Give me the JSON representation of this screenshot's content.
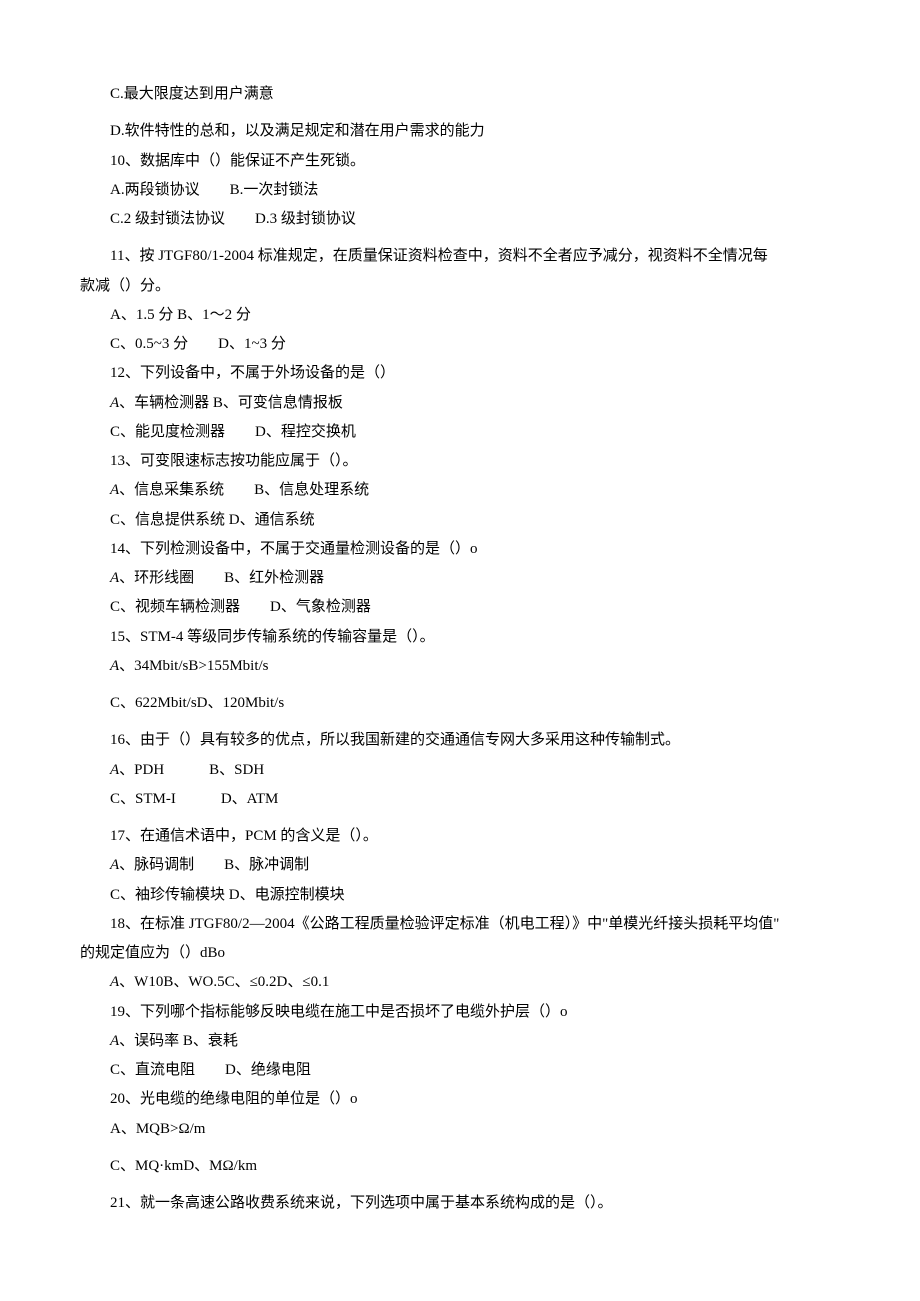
{
  "lines": [
    "C.最大限度达到用户满意",
    "D.软件特性的总和，以及满足规定和潜在用户需求的能力",
    "10、数据库中（）能保证不产生死锁。",
    "A.两段锁协议  B.一次封锁法",
    "C.2 级封锁法协议  D.3 级封锁协议",
    "11、按 JTGF80/1-2004 标准规定，在质量保证资料检查中，资料不全者应予减分，视资料不全情况每",
    "款减（）分。",
    "A、1.5 分 B、1～2 分",
    "C、0.5~3 分  D、1~3 分",
    "12、下列设备中，不属于外场设备的是（）",
    "<span class=\"italic-a\">A</span>、车辆检测器 B、可变信息情报板",
    "C、能见度检测器  D、程控交换机",
    "13、可变限速标志按功能应属于（）。",
    "<span class=\"italic-a\">A</span>、信息采集系统  B、信息处理系统",
    "C、信息提供系统 D、通信系统",
    "14、下列检测设备中，不属于交通量检测设备的是（）o",
    "<span class=\"italic-a\">A</span>、环形线圈  B、红外检测器",
    "C、视频车辆检测器  D、气象检测器",
    "15、STM-4 等级同步传输系统的传输容量是（）。",
    "<span class=\"italic-a\">A</span>、34Mbit/sB>155Mbit/s",
    "C、622Mbit/sD、120Mbit/s",
    "16、由于（）具有较多的优点，所以我国新建的交通通信专网大多采用这种传输制式。",
    "<span class=\"italic-a\">A</span>、PDH   B、SDH",
    "C、STM-I   D、ATM",
    "17、在通信术语中，PCM 的含义是（）。",
    "<span class=\"italic-a\">A</span>、脉码调制  B、脉冲调制",
    "C、袖珍传输模块 D、电源控制模块",
    "18、在标准 JTGF80/2—2004《公路工程质量检验评定标准（机电工程）》中\"单模光纤接头损耗平均值\"",
    "的规定值应为（）dBo",
    "<span class=\"italic-a\">A</span>、W10B、WO.5C、≤0.2D、≤0.1",
    "19、下列哪个指标能够反映电缆在施工中是否损坏了电缆外护层（）o",
    "<span class=\"italic-a\">A</span>、误码率 B、衰耗",
    "C、直流电阻  D、绝缘电阻",
    "20、光电缆的绝缘电阻的单位是（）o",
    "A、MQB>Ω/m",
    "C、MQ·kmD、MΩ/km",
    "21、就一条高速公路收费系统来说，下列选项中属于基本系统构成的是（）。"
  ],
  "meta": {
    "noIndentIndexes": [
      6,
      28
    ],
    "spacerAfter": [
      0,
      4,
      19,
      20,
      23,
      34,
      35
    ]
  }
}
